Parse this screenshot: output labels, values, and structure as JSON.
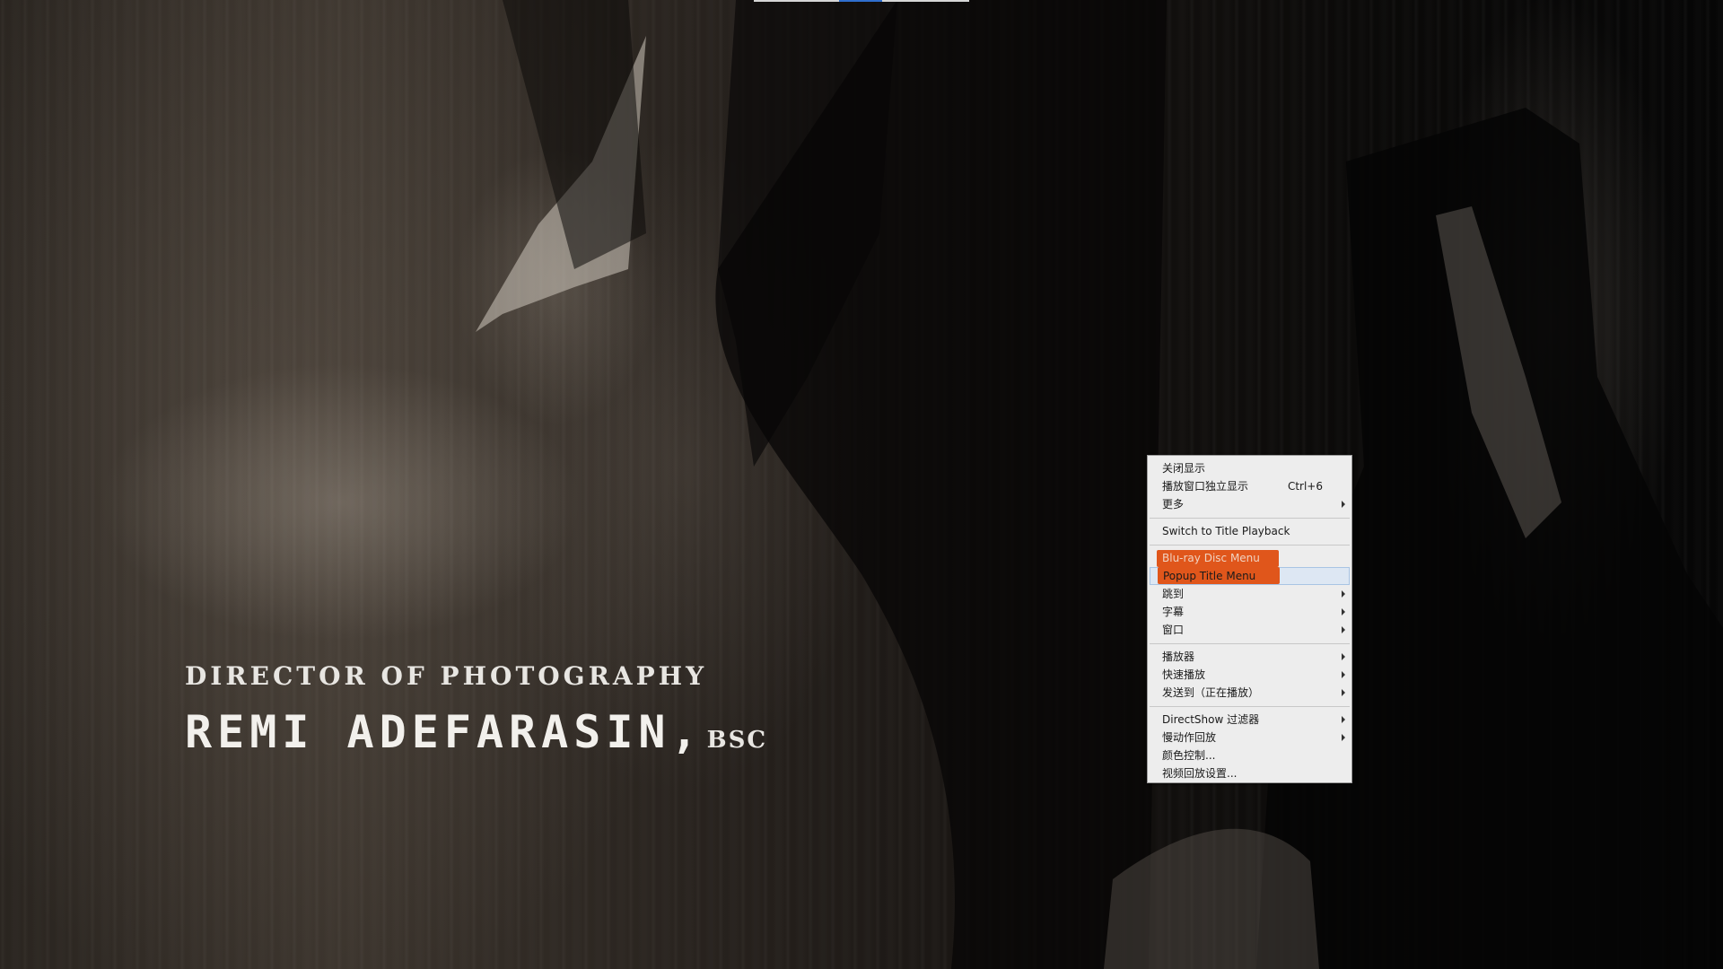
{
  "credit": {
    "role": "DIRECTOR OF PHOTOGRAPHY",
    "name": "REMI ADEFARASIN,",
    "suffix": "BSC"
  },
  "context_menu": {
    "items": [
      {
        "label": "关闭显示"
      },
      {
        "label": "播放窗口独立显示",
        "shortcut": "Ctrl+6"
      },
      {
        "label": "更多",
        "submenu": true
      },
      {
        "label": "Switch to Title Playback"
      },
      {
        "label": "Blu-ray Disc Menu",
        "disabled": true
      },
      {
        "label": "Popup Title Menu"
      },
      {
        "label": "跳到",
        "submenu": true
      },
      {
        "label": "字幕",
        "submenu": true
      },
      {
        "label": "窗口",
        "submenu": true
      },
      {
        "label": "播放器",
        "submenu": true
      },
      {
        "label": "快速播放",
        "submenu": true
      },
      {
        "label": "发送到（正在播放）",
        "submenu": true
      },
      {
        "label": "DirectShow 过滤器",
        "submenu": true
      },
      {
        "label": "慢动作回放",
        "submenu": true
      },
      {
        "label": "颜色控制..."
      },
      {
        "label": "视频回放设置..."
      }
    ]
  },
  "colors": {
    "highlight_annotation": "#e0561b",
    "menu_background": "#ededed",
    "hover_background": "#dde7f3"
  }
}
